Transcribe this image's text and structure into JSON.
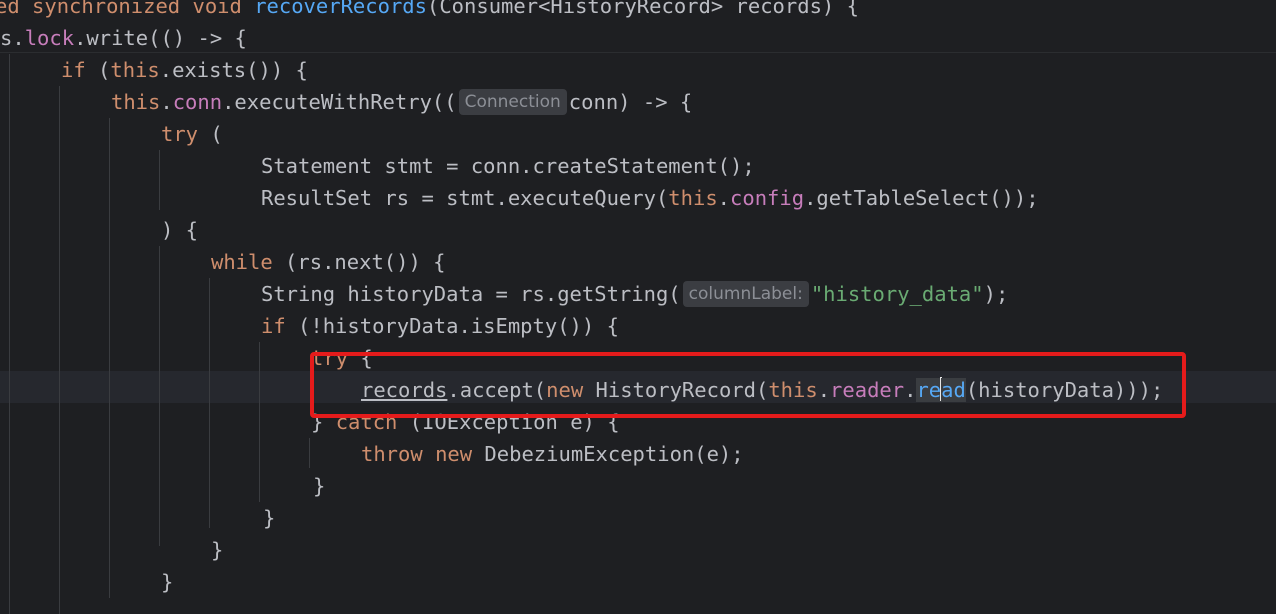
{
  "editor": {
    "colors": {
      "background": "#1e1f22",
      "keyword": "#cf8e6d",
      "method": "#56a8f5",
      "field": "#c77dbb",
      "string": "#6aab73",
      "text": "#bcbec4",
      "annotation": "#e51b1b"
    },
    "lines": [
      {
        "tokens": [
          {
            "t": "ed synchronized void ",
            "c": "kw"
          },
          {
            "t": "recoverRecords",
            "c": "fn"
          },
          {
            "t": "(Consumer<HistoryRecord> records) {",
            "c": "plain"
          }
        ]
      },
      {
        "tokens": [
          {
            "t": "s.",
            "c": "plain"
          },
          {
            "t": "lock",
            "c": "field"
          },
          {
            "t": ".write(() -> {",
            "c": "plain"
          }
        ]
      },
      {
        "tokens": [
          {
            "t": "if",
            "c": "kw"
          },
          {
            "t": " (",
            "c": "plain"
          },
          {
            "t": "this",
            "c": "kw"
          },
          {
            "t": ".exists()) {",
            "c": "plain"
          }
        ]
      },
      {
        "tokens": [
          {
            "t": "this",
            "c": "kw"
          },
          {
            "t": ".",
            "c": "plain"
          },
          {
            "t": "conn",
            "c": "field"
          },
          {
            "t": ".executeWithRetry((",
            "c": "plain"
          },
          {
            "t": "Connection",
            "c": "hint"
          },
          {
            "t": "conn) -> {",
            "c": "plain"
          }
        ]
      },
      {
        "tokens": [
          {
            "t": "try",
            "c": "kw"
          },
          {
            "t": " (",
            "c": "plain"
          }
        ]
      },
      {
        "tokens": [
          {
            "t": "Statement stmt = conn.createStatement();",
            "c": "plain"
          }
        ]
      },
      {
        "tokens": [
          {
            "t": "ResultSet rs = stmt.executeQuery(",
            "c": "plain"
          },
          {
            "t": "this",
            "c": "kw"
          },
          {
            "t": ".",
            "c": "plain"
          },
          {
            "t": "config",
            "c": "field"
          },
          {
            "t": ".getTableSelect());",
            "c": "plain"
          }
        ]
      },
      {
        "tokens": [
          {
            "t": ") {",
            "c": "plain"
          }
        ]
      },
      {
        "tokens": [
          {
            "t": "while",
            "c": "kw"
          },
          {
            "t": " (rs.next()) {",
            "c": "plain"
          }
        ]
      },
      {
        "tokens": [
          {
            "t": "String historyData = rs.getString(",
            "c": "plain"
          },
          {
            "t": "columnLabel:",
            "c": "hint"
          },
          {
            "t": "\"history_data\"",
            "c": "str"
          },
          {
            "t": ");",
            "c": "plain"
          }
        ]
      },
      {
        "tokens": [
          {
            "t": "if",
            "c": "kw"
          },
          {
            "t": " (!historyData.isEmpty()) {",
            "c": "plain"
          }
        ]
      },
      {
        "tokens": [
          {
            "t": "try",
            "c": "kw"
          },
          {
            "t": " {",
            "c": "plain"
          }
        ]
      },
      {
        "tokens": [
          {
            "t": "records",
            "c": "uline"
          },
          {
            "t": ".accept(",
            "c": "plain"
          },
          {
            "t": "new",
            "c": "kw"
          },
          {
            "t": " HistoryRecord(",
            "c": "plain"
          },
          {
            "t": "this",
            "c": "kw"
          },
          {
            "t": ".",
            "c": "plain"
          },
          {
            "t": "reader",
            "c": "field"
          },
          {
            "t": ".",
            "c": "plain"
          },
          {
            "t": "re",
            "c": "caretword"
          },
          {
            "t": "",
            "c": "caret"
          },
          {
            "t": "ad",
            "c": "caretword"
          },
          {
            "t": "(historyData)));",
            "c": "plain"
          }
        ]
      },
      {
        "tokens": [
          {
            "t": "} ",
            "c": "plain"
          },
          {
            "t": "catch",
            "c": "kw"
          },
          {
            "t": " (IOException e) {",
            "c": "plain"
          }
        ]
      },
      {
        "tokens": [
          {
            "t": "throw",
            "c": "kw"
          },
          {
            "t": " ",
            "c": "plain"
          },
          {
            "t": "new",
            "c": "kw"
          },
          {
            "t": " DebeziumException(e);",
            "c": "plain"
          }
        ]
      },
      {
        "tokens": [
          {
            "t": "}",
            "c": "plain"
          }
        ]
      },
      {
        "tokens": [
          {
            "t": "}",
            "c": "plain"
          }
        ]
      },
      {
        "tokens": [
          {
            "t": "}",
            "c": "plain"
          }
        ]
      },
      {
        "tokens": [
          {
            "t": "}",
            "c": "plain"
          }
        ]
      }
    ]
  }
}
